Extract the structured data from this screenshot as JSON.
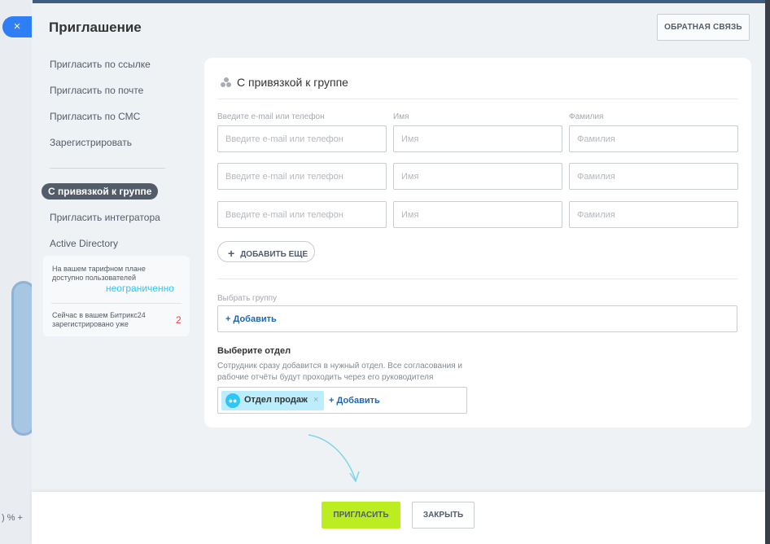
{
  "window": {
    "title": "Приглашение",
    "feedback_label": "ОБРАТНАЯ СВЯЗЬ",
    "close_glyph": "×",
    "bottom_left_text": ") % +"
  },
  "sidebar": {
    "items": [
      {
        "label": "Пригласить по ссылке"
      },
      {
        "label": "Пригласить по почте"
      },
      {
        "label": "Пригласить по СМС"
      },
      {
        "label": "Зарегистрировать"
      },
      {
        "label": "С привязкой к группе",
        "active": true
      },
      {
        "label": "Пригласить интегратора"
      },
      {
        "label": "Active Directory"
      }
    ],
    "info": {
      "plan_text": "На вашем тарифном плане доступно пользователей",
      "plan_value": "неограниченно",
      "registered_text": "Сейчас в вашем Битрикс24 зарегистрировано уже",
      "registered_value": "2"
    }
  },
  "form": {
    "section_title": "С привязкой к группе",
    "section_icon": "group-icon",
    "columns": {
      "contact": "Введите e-mail или телефон",
      "name": "Имя",
      "surname": "Фамилия"
    },
    "rows": [
      {
        "contact_placeholder": "Введите e-mail или телефон",
        "name_placeholder": "Имя",
        "surname_placeholder": "Фамилия"
      },
      {
        "contact_placeholder": "Введите e-mail или телефон",
        "name_placeholder": "Имя",
        "surname_placeholder": "Фамилия"
      },
      {
        "contact_placeholder": "Введите e-mail или телефон",
        "name_placeholder": "Имя",
        "surname_placeholder": "Фамилия"
      }
    ],
    "add_more_label": "ДОБАВИТЬ ЕЩЕ",
    "group_label": "Выбрать группу",
    "group_add": "+ Добавить",
    "department": {
      "title": "Выберите отдел",
      "description": "Сотрудник сразу добавится в нужный отдел. Все согласования и рабочие отчёты будут проходить через его руководителя",
      "tag": "Отдел продаж",
      "add": "+ Добавить"
    }
  },
  "footer": {
    "invite_label": "ПРИГЛАСИТЬ",
    "close_label": "ЗАКРЫТЬ"
  },
  "colors": {
    "accent_green": "#bbed21",
    "link_blue": "#2067b0",
    "info_cyan": "#2fc6f6",
    "info_red": "#f3423f"
  }
}
